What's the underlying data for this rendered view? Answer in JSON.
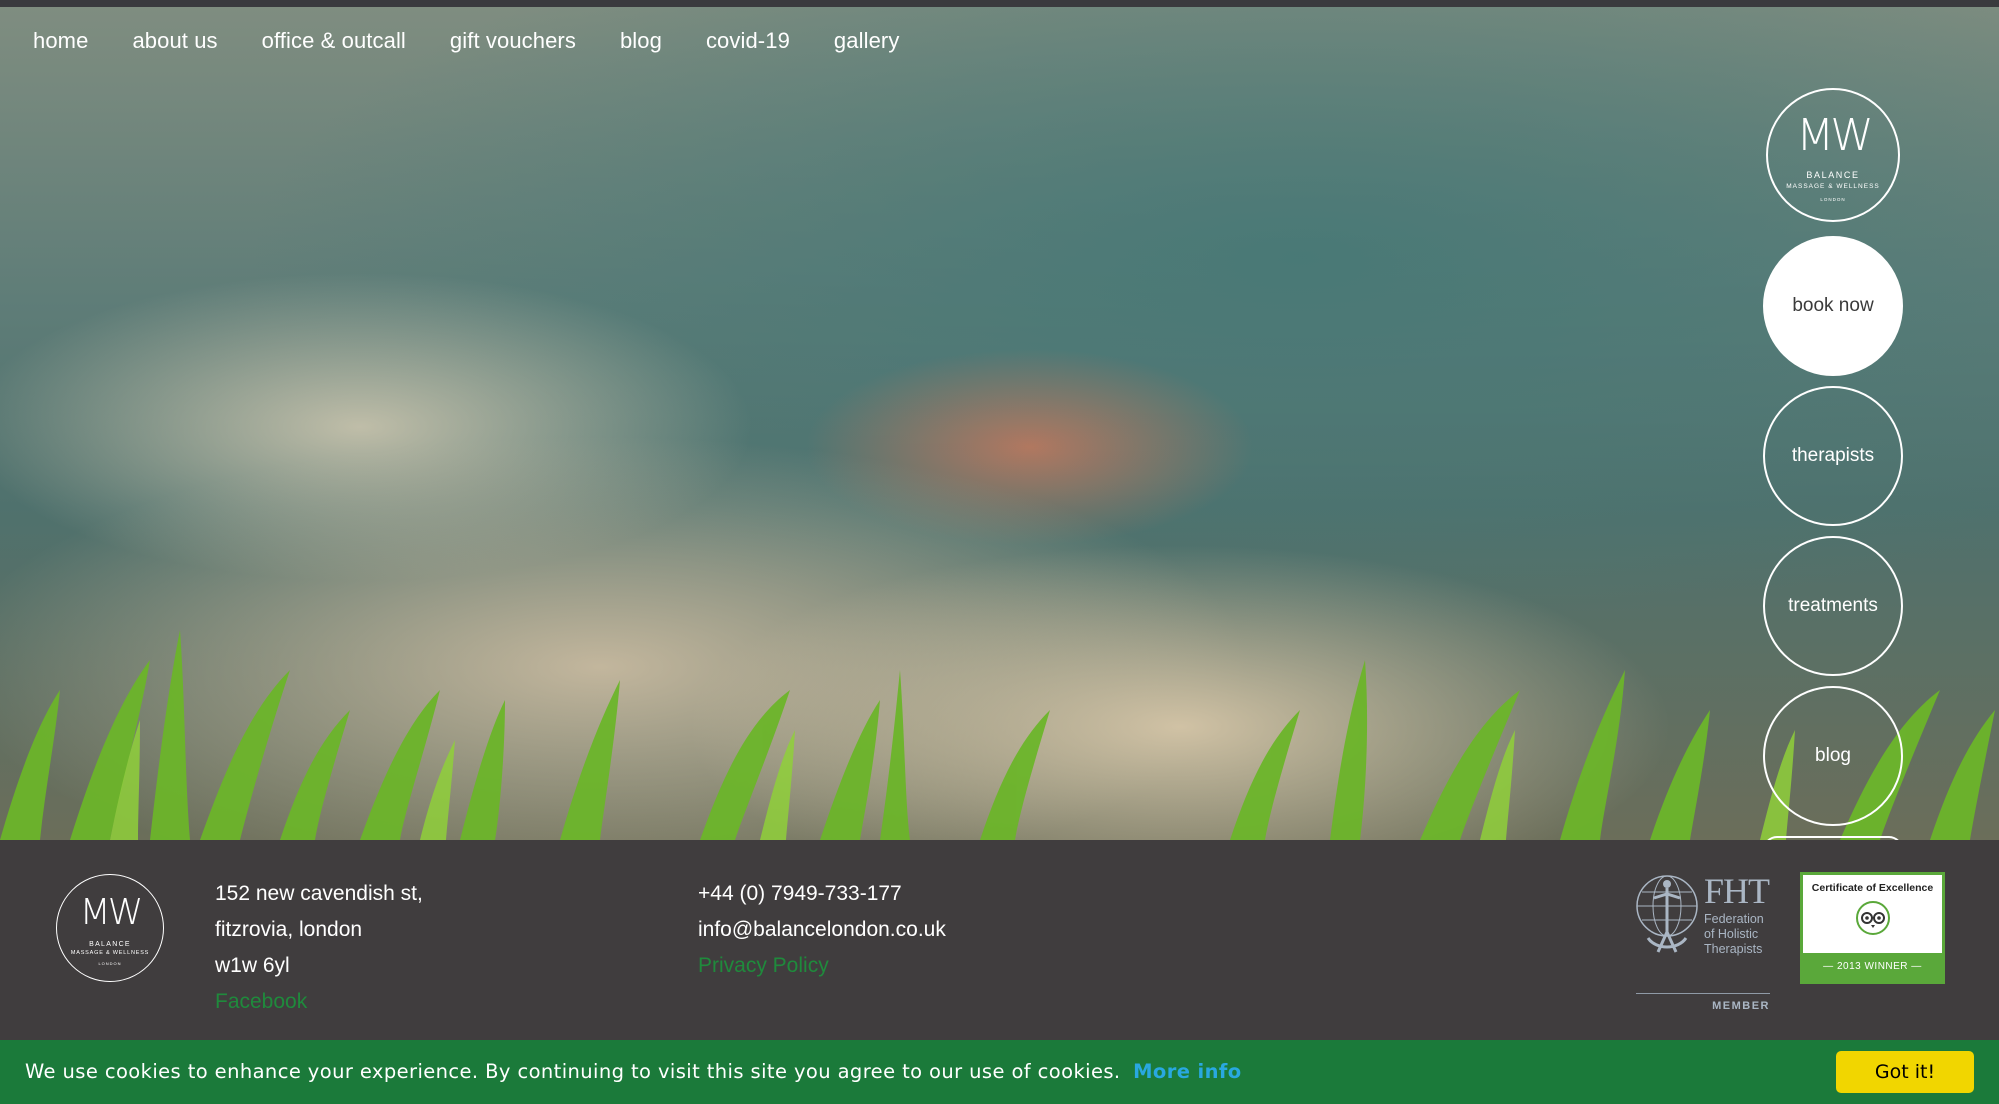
{
  "nav": {
    "items": [
      {
        "label": "home"
      },
      {
        "label": "about us"
      },
      {
        "label": "office & outcall"
      },
      {
        "label": "gift vouchers"
      },
      {
        "label": "blog"
      },
      {
        "label": "covid-19"
      },
      {
        "label": "gallery"
      }
    ]
  },
  "logo": {
    "monogram": "MW",
    "brand": "BALANCE",
    "tagline": "MASSAGE & WELLNESS",
    "city": "LONDON"
  },
  "side_buttons": {
    "book_now": "book now",
    "therapists": "therapists",
    "treatments": "treatments",
    "blog": "blog"
  },
  "footer": {
    "address": [
      "152 new cavendish st,",
      "fitzrovia, london",
      "w1w 6yl"
    ],
    "facebook": "Facebook",
    "phone": "+44 (0) 7949-733-177",
    "email": "info@balancelondon.co.uk",
    "privacy": "Privacy Policy",
    "fht": {
      "abbr": "FHT",
      "lines": [
        "Federation",
        "of Holistic",
        "Therapists"
      ],
      "member": "MEMBER"
    },
    "tripadvisor": {
      "title": "Certificate of Excellence",
      "ribbon": "— 2013 WINNER —"
    }
  },
  "cookie": {
    "message": "We use cookies to enhance your experience. By continuing to visit this site you agree to our use of cookies.",
    "more_info": "More info",
    "accept": "Got it!"
  },
  "colors": {
    "footer_bg": "#403d3e",
    "cookie_bg": "#1b7a3a",
    "link_green": "#1f8a3c",
    "more_info_blue": "#29a8e0",
    "accept_yellow": "#f1d600"
  }
}
